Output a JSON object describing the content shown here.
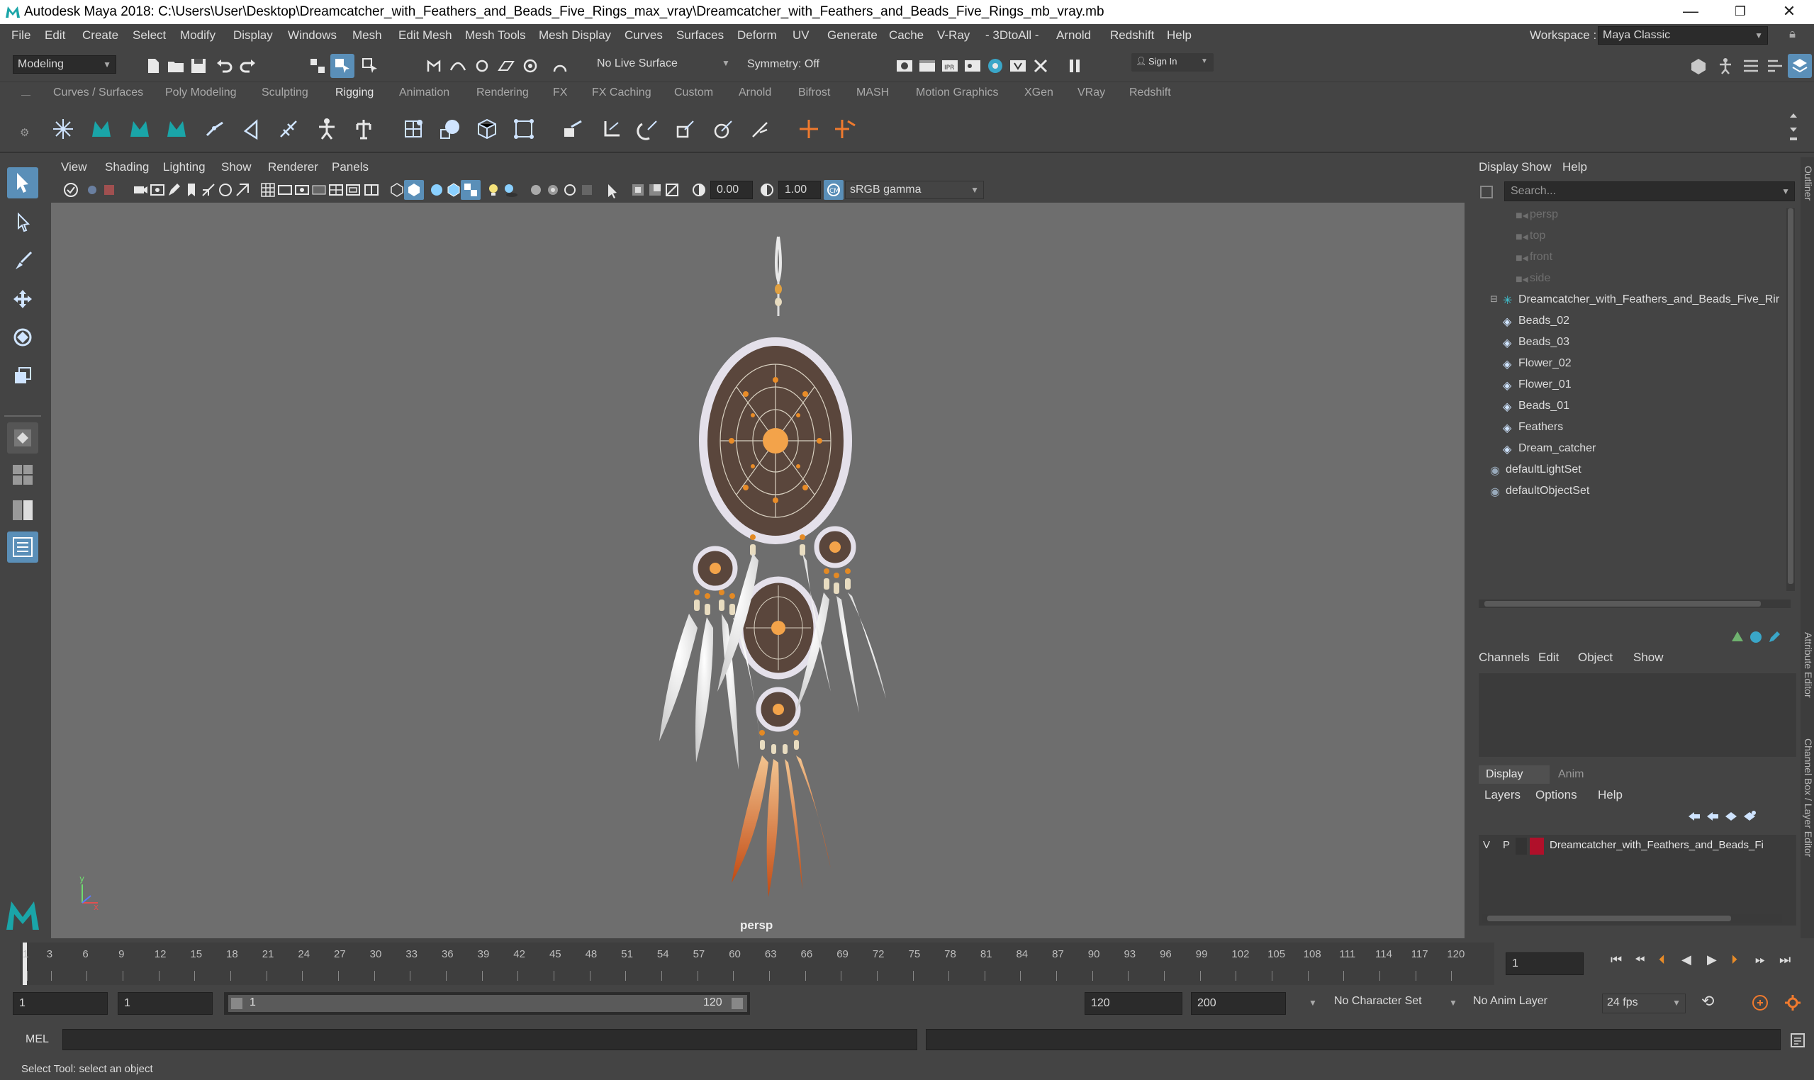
{
  "window": {
    "title": "Autodesk Maya 2018: C:\\Users\\User\\Desktop\\Dreamcatcher_with_Feathers_and_Beads_Five_Rings_max_vray\\Dreamcatcher_with_Feathers_and_Beads_Five_Rings_mb_vray.mb",
    "minimize": "—",
    "maximize": "❐",
    "close": "✕"
  },
  "menubar": {
    "items": [
      "File",
      "Edit",
      "Create",
      "Select",
      "Modify",
      "Display",
      "Windows",
      "Mesh",
      "Edit Mesh",
      "Mesh Tools",
      "Mesh Display",
      "Curves",
      "Surfaces",
      "Deform",
      "UV",
      "Generate",
      "Cache",
      "V-Ray",
      "- 3DtoAll -",
      "Arnold",
      "Redshift",
      "Help"
    ],
    "workspace_label": "Workspace :",
    "workspace_value": "Maya Classic"
  },
  "statusline": {
    "mode": "Modeling",
    "live_surface": "No Live Surface",
    "symmetry": "Symmetry: Off",
    "sign_in": "Sign In"
  },
  "shelf": {
    "tabs": [
      "Curves / Surfaces",
      "Poly Modeling",
      "Sculpting",
      "Rigging",
      "Animation",
      "Rendering",
      "FX",
      "FX Caching",
      "Custom",
      "Arnold",
      "Bifrost",
      "MASH",
      "Motion Graphics",
      "XGen",
      "VRay",
      "Redshift"
    ],
    "active_tab": "Rigging"
  },
  "panel": {
    "menus": [
      "View",
      "Shading",
      "Lighting",
      "Show",
      "Renderer",
      "Panels"
    ],
    "exposure": "0.00",
    "gamma": "1.00",
    "color_space": "sRGB gamma",
    "camera_label": "persp"
  },
  "outliner": {
    "menus": [
      "Display",
      "Show",
      "Help"
    ],
    "search_placeholder": "Search...",
    "cameras": [
      "persp",
      "top",
      "front",
      "side"
    ],
    "group": "Dreamcatcher_with_Feathers_and_Beads_Five_Rir",
    "children": [
      "Beads_02",
      "Beads_03",
      "Flower_02",
      "Flower_01",
      "Beads_01",
      "Feathers",
      "Dream_catcher"
    ],
    "sets": [
      "defaultLightSet",
      "defaultObjectSet"
    ]
  },
  "channelbox": {
    "menus": [
      "Channels",
      "Edit",
      "Object",
      "Show"
    ],
    "layer_tabs": [
      "Display",
      "Anim"
    ],
    "layer_menus": [
      "Layers",
      "Options",
      "Help"
    ],
    "layer": {
      "v": "V",
      "p": "P",
      "name": "Dreamcatcher_with_Feathers_and_Beads_Fi",
      "color": "#b0102a"
    }
  },
  "right_tabs": [
    "Outliner",
    "Attribute Editor",
    "Channel Box / Layer Editor"
  ],
  "timeline": {
    "ticks": [
      "1",
      "3",
      "6",
      "9",
      "12",
      "15",
      "18",
      "21",
      "24",
      "27",
      "30",
      "33",
      "36",
      "39",
      "42",
      "45",
      "48",
      "51",
      "54",
      "57",
      "60",
      "63",
      "66",
      "69",
      "72",
      "75",
      "78",
      "81",
      "84",
      "87",
      "90",
      "93",
      "96",
      "99",
      "102",
      "105",
      "108",
      "111",
      "114",
      "117",
      "120"
    ],
    "current_frame": "1"
  },
  "range": {
    "start": "1",
    "playback_start": "1",
    "slider_start": "1",
    "slider_end": "120",
    "playback_end": "120",
    "end": "200",
    "character_set": "No Character Set",
    "anim_layer": "No Anim Layer",
    "fps": "24 fps"
  },
  "cmdline": {
    "label": "MEL"
  },
  "helpline": {
    "text": "Select Tool: select an object"
  },
  "colors": {
    "accent": "#5a8fb8",
    "viewport_bg": "#6e6e6e",
    "panel_bg": "#444444"
  }
}
